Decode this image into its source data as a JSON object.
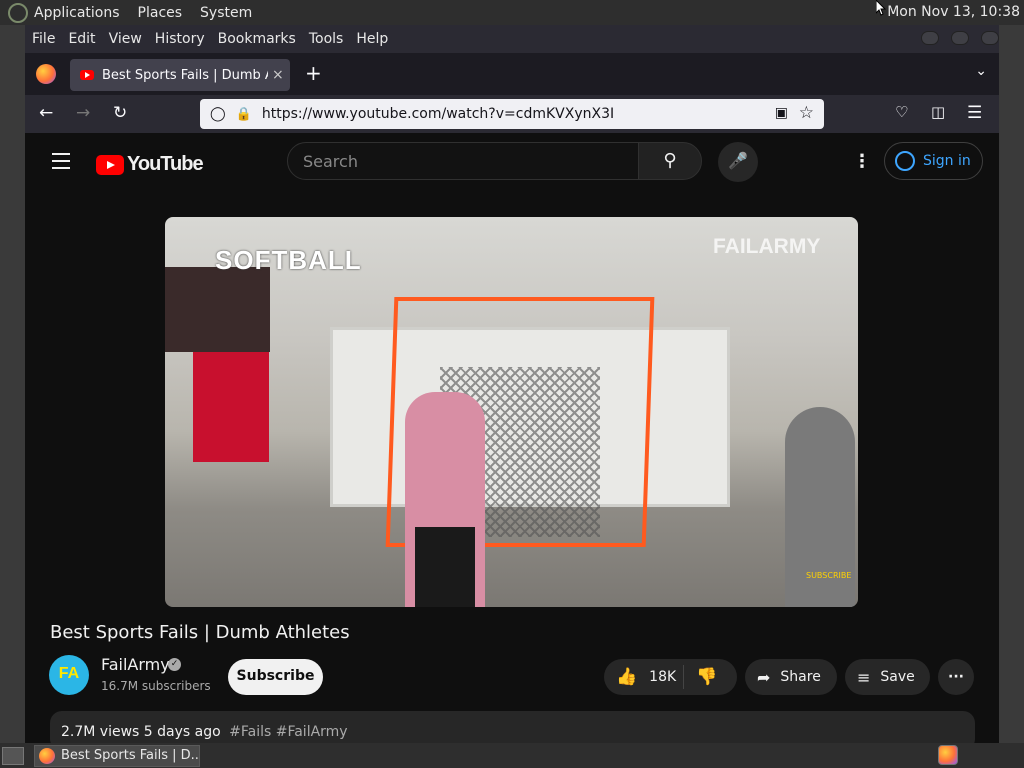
{
  "desktop": {
    "menus": [
      "Applications",
      "Places",
      "System"
    ],
    "clock": "Mon Nov 13, 10:38"
  },
  "browser": {
    "menubar": [
      "File",
      "Edit",
      "View",
      "History",
      "Bookmarks",
      "Tools",
      "Help"
    ],
    "tab": {
      "title": "Best Sports Fails | Dumb Athletes",
      "close": "×"
    },
    "new_tab": "+",
    "url": "https://www.youtube.com/watch?v=cdmKVXynX3I"
  },
  "youtube": {
    "logo_text": "YouTube",
    "search_placeholder": "Search",
    "sign_in": "Sign in",
    "video": {
      "overlay_left": "SOFTBALL",
      "overlay_right": "FAILARMY",
      "overlay_subscribe": "SUBSCRIBE"
    },
    "title": "Best Sports Fails | Dumb Athletes",
    "channel": {
      "avatar_text": "FA",
      "name": "FailArmy",
      "subscribers": "16.7M subscribers"
    },
    "subscribe": "Subscribe",
    "likes": "18K",
    "share": "Share",
    "save": "Save",
    "more": "···",
    "description": {
      "views": "2.7M views",
      "age": "5 days ago",
      "tags": "#Fails #FailArmy"
    }
  },
  "taskbar": {
    "task_title": "Best Sports Fails | D..."
  }
}
